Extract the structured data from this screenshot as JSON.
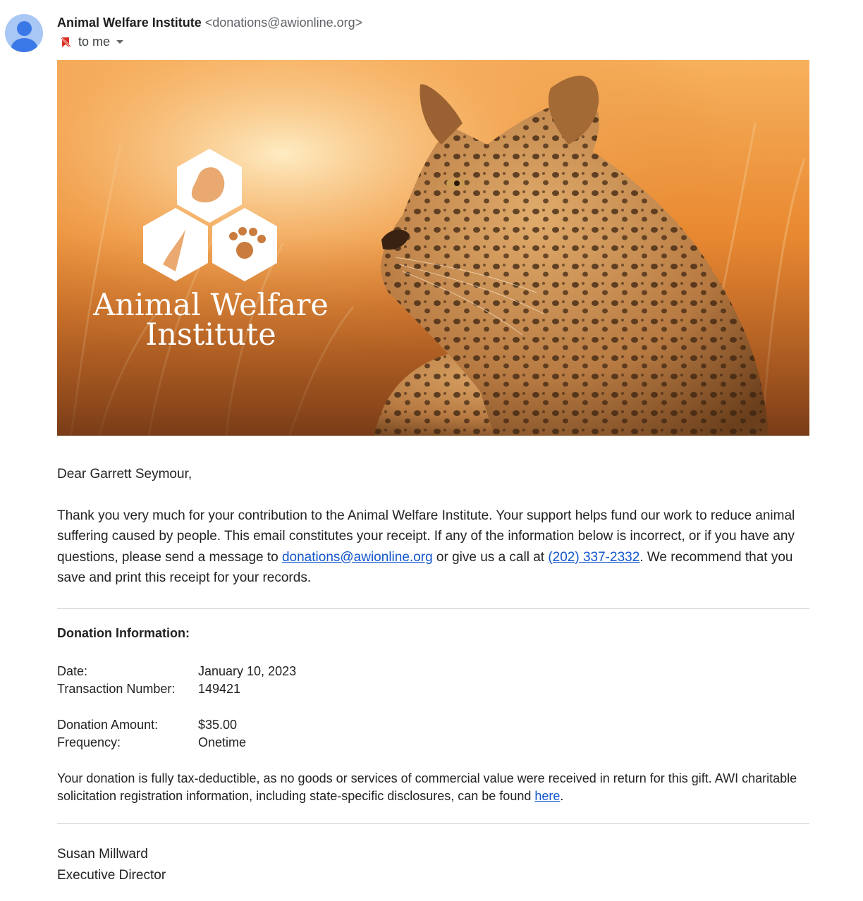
{
  "header": {
    "sender_name": "Animal Welfare Institute",
    "sender_email": "<donations@awionline.org>",
    "to_label": "to me"
  },
  "hero": {
    "logo_line1": "Animal Welfare",
    "logo_line2": "Institute"
  },
  "body": {
    "greeting": "Dear Garrett Seymour,",
    "para1_a": "Thank you very much for your contribution to the Animal Welfare Institute. Your support helps fund our work to reduce animal suffering caused by people. This email constitutes your receipt. If any of the information below is incorrect, or if you have any questions, please send a message to ",
    "email_link": "donations@awionline.org",
    "para1_b": " or give us a call at ",
    "phone_link": "(202) 337-2332",
    "para1_c": ". We recommend that you save and print this receipt for your records."
  },
  "donation": {
    "title": "Donation Information:",
    "date_label": "Date:",
    "date_value": "January 10, 2023",
    "txn_label": "Transaction Number:",
    "txn_value": "149421",
    "amount_label": "Donation Amount:",
    "amount_value": "$35.00",
    "freq_label": "Frequency:",
    "freq_value": "Onetime"
  },
  "tax": {
    "text_a": "Your donation is fully tax-deductible, as no goods or services of commercial value were received in return for this gift. AWI charitable solicitation registration information, including state-specific disclosures, can be found ",
    "link": "here",
    "text_b": "."
  },
  "signature": {
    "name": "Susan Millward",
    "title": "Executive Director"
  },
  "colors": {
    "link": "#1155cc",
    "avatar_bg": "#a9c7f5",
    "avatar_fg": "#3b78e7"
  },
  "icons": {
    "avatar": "person-icon",
    "importance": "importance-off-icon",
    "dropdown": "caret-down-icon"
  }
}
